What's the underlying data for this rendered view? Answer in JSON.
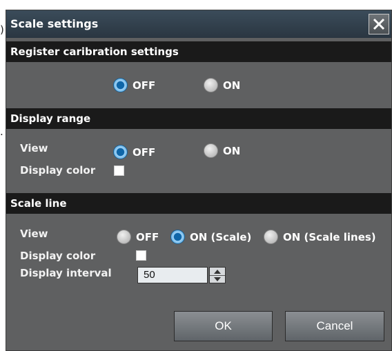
{
  "left_margin_marks": {
    "top": ")",
    "middle": "."
  },
  "dialog": {
    "title": "Scale settings",
    "close_icon": "close-x-icon"
  },
  "sections": {
    "register": {
      "header": "Register caribration settings",
      "options": [
        "OFF",
        "ON"
      ],
      "selected": "OFF"
    },
    "display_range": {
      "header": "Display range",
      "view_label": "View",
      "options": [
        "OFF",
        "ON"
      ],
      "selected": "OFF",
      "display_color_label": "Display color",
      "display_color": "#ffffff"
    },
    "scale_line": {
      "header": "Scale line",
      "view_label": "View",
      "options": [
        "OFF",
        "ON (Scale)",
        "ON (Scale lines)"
      ],
      "selected": "ON (Scale)",
      "display_color_label": "Display color",
      "display_color": "#ffffff",
      "interval_label": "Display interval",
      "interval_value": "50"
    }
  },
  "buttons": {
    "ok": "OK",
    "cancel": "Cancel"
  },
  "colors": {
    "section_header": "#1a1a1a",
    "dialog_bg": "#5f6061",
    "radio_selected": "#1f7cc4"
  }
}
